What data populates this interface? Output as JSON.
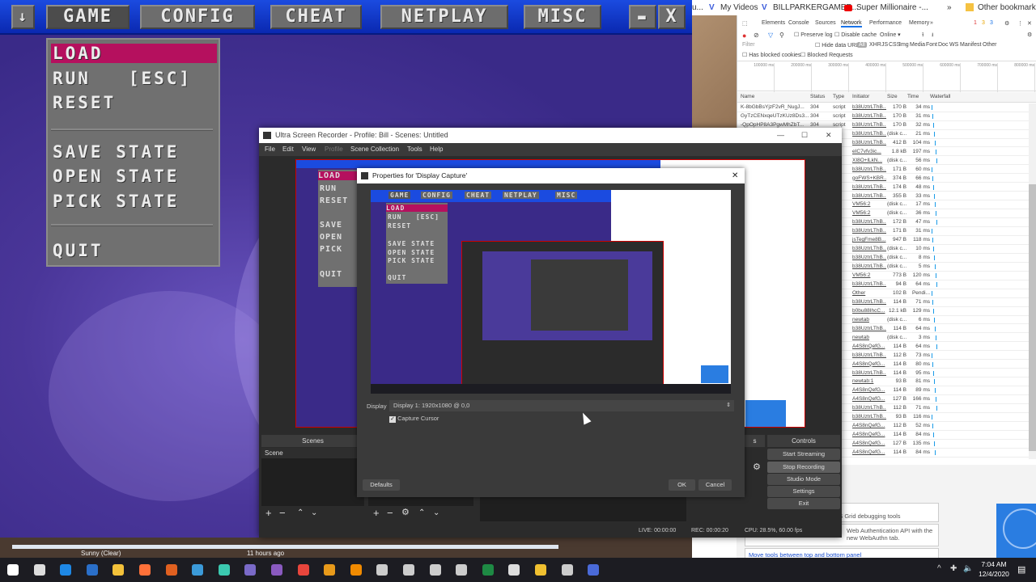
{
  "game": {
    "topbar": {
      "down_icon": "↓",
      "tabs": [
        "GAME",
        "CONFIG",
        "CHEAT",
        "NETPLAY",
        "MISC"
      ],
      "active": "GAME",
      "minimize_icon": "minimize-icon",
      "close_label": "X"
    },
    "menu": {
      "items": [
        "LOAD",
        "RUN   [ESC]",
        "RESET",
        "SAVE STATE",
        "OPEN STATE",
        "PICK STATE",
        "QUIT"
      ],
      "selected": "LOAD"
    },
    "colors": {
      "bar": "#1b4be0",
      "menu": "#707070",
      "highlight": "#b5105e",
      "bg": "#3a2a88"
    }
  },
  "chrome": {
    "bookmarks": [
      "u...",
      "My Videos",
      "BILLPARKERGAMER...",
      "Super Millionaire -...",
      "»",
      "Other bookmarks"
    ],
    "devtools": {
      "tabs": [
        "Elements",
        "Console",
        "Sources",
        "Network",
        "Performance",
        "Memory",
        "»"
      ],
      "active_tab": "Network",
      "counts": {
        "errors": "1",
        "warnings": "3",
        "info": "3"
      },
      "toolbar": {
        "preserve_log": "Preserve log",
        "disable_cache": "Disable cache",
        "throttle": "Online"
      },
      "filter": {
        "placeholder": "Filter",
        "hide_data_urls": "Hide data URLs",
        "types": [
          "All",
          "XHR",
          "JS",
          "CSS",
          "Img",
          "Media",
          "Font",
          "Doc",
          "WS",
          "Manifest",
          "Other"
        ],
        "blocked_cookies": "Has blocked cookies",
        "blocked_requests": "Blocked Requests"
      },
      "overview_ticks": [
        "100000 ms",
        "200000 ms",
        "300000 ms",
        "400000 ms",
        "500000 ms",
        "600000 ms",
        "700000 ms",
        "800000 ms"
      ],
      "columns": [
        "Name",
        "Status",
        "Type",
        "Initiator",
        "Size",
        "Time",
        "Waterfall"
      ],
      "rows": [
        {
          "name": "K-8bGbBsYjzF2vR_NugJ...",
          "status": "304",
          "type": "script",
          "initiator": "b38UztrLThB...",
          "size": "170 B",
          "time": "34 ms"
        },
        {
          "name": "GyTzCENxqeUTzKUz8Ds3...",
          "status": "304",
          "type": "script",
          "initiator": "b38UztrLThB...",
          "size": "170 B",
          "time": "31 ms"
        },
        {
          "name": "-QpOpHP8A3PgwMhZbT...",
          "status": "304",
          "type": "script",
          "initiator": "b38UztrLThB...",
          "size": "170 B",
          "time": "32 ms"
        },
        {
          "initiator": "b38UztrLThB...",
          "size": "(disk c...",
          "time": "21 ms"
        },
        {
          "initiator": "b38UztrLThB...",
          "size": "412 B",
          "time": "104 ms"
        },
        {
          "initiator": "eIC7vfv3ic...",
          "size": "1.8 kB",
          "time": "197 ms"
        },
        {
          "initiator": "XI8O+lLkN...",
          "size": "(disk c...",
          "time": "56 ms"
        },
        {
          "initiator": "b38UztrLThB...",
          "size": "171 B",
          "time": "60 ms"
        },
        {
          "initiator": "goFWS+KBR...",
          "size": "374 B",
          "time": "66 ms"
        },
        {
          "initiator": "b38UztrLThB...",
          "size": "174 B",
          "time": "48 ms"
        },
        {
          "initiator": "b38UztrLThB...",
          "size": "355 B",
          "time": "33 ms"
        },
        {
          "initiator": "VM56:2",
          "size": "(disk c...",
          "time": "17 ms"
        },
        {
          "initiator": "VM56:2",
          "size": "(disk c...",
          "time": "36 ms"
        },
        {
          "initiator": "b38UztrLThB...",
          "size": "172 B",
          "time": "47 ms"
        },
        {
          "initiator": "b38UztrLThB...",
          "size": "171 B",
          "time": "31 ms"
        },
        {
          "initiator": "jsTegFme8B...",
          "size": "947 B",
          "time": "118 ms"
        },
        {
          "initiator": "b38UztrLThB...",
          "size": "(disk c...",
          "time": "10 ms"
        },
        {
          "initiator": "b38UztrLThB...",
          "size": "(disk c...",
          "time": "8 ms"
        },
        {
          "initiator": "b38UztrLThB...",
          "size": "(disk c...",
          "time": "5 ms"
        },
        {
          "initiator": "VM56:2",
          "size": "773 B",
          "time": "120 ms"
        },
        {
          "initiator": "b38UztrLThB...",
          "size": "94 B",
          "time": "64 ms"
        },
        {
          "initiator": "Other",
          "size": "102 B",
          "time": "Pendi..."
        },
        {
          "initiator": "b38UztrLThB...",
          "size": "114 B",
          "time": "71 ms"
        },
        {
          "initiator": "b0bu88IhcC...",
          "size": "12.1 kB",
          "time": "129 ms"
        },
        {
          "initiator": "newtab",
          "size": "(disk c...",
          "time": "6 ms"
        },
        {
          "initiator": "b38UztrLThB...",
          "size": "114 B",
          "time": "64 ms"
        },
        {
          "initiator": "newtab",
          "size": "(disk c...",
          "time": "3 ms"
        },
        {
          "initiator": "A4S8nQefG...",
          "size": "114 B",
          "time": "64 ms"
        },
        {
          "initiator": "b38UztrLThB...",
          "size": "112 B",
          "time": "73 ms"
        },
        {
          "initiator": "A4S8nQefG...",
          "size": "114 B",
          "time": "80 ms"
        },
        {
          "initiator": "b38UztrLThB...",
          "size": "114 B",
          "time": "95 ms"
        },
        {
          "initiator": "newtab:1",
          "size": "93 B",
          "time": "81 ms"
        },
        {
          "initiator": "A4S8nQefG...",
          "size": "114 B",
          "time": "89 ms"
        },
        {
          "initiator": "A4S8nQefG...",
          "size": "127 B",
          "time": "166 ms"
        },
        {
          "initiator": "b38UztrLThB...",
          "size": "112 B",
          "time": "71 ms"
        },
        {
          "initiator": "b38UztrLThB...",
          "size": "93 B",
          "time": "116 ms"
        },
        {
          "initiator": "A4S8nQefG...",
          "size": "112 B",
          "time": "52 ms"
        },
        {
          "initiator": "A4S8nQefG...",
          "size": "114 B",
          "time": "84 ms"
        },
        {
          "initiator": "A4S8nQefG...",
          "size": "127 B",
          "time": "135 ms"
        },
        {
          "initiator": "A4S8nQefG...",
          "size": "114 B",
          "time": "84 ms"
        }
      ],
      "summary": "sources"
    },
    "newtab_cards": [
      "v CSS Grid debugging tools",
      "Web Authentication API with the new WebAuthn tab.",
      "Move tools between top and bottom panel"
    ]
  },
  "obs": {
    "title": "Ultra Screen Recorder - Profile: Bill - Scenes: Untitled",
    "menu": [
      "File",
      "Edit",
      "View",
      "Profile",
      "Scene Collection",
      "Tools",
      "Help"
    ],
    "scenes": {
      "header": "Scenes",
      "items": [
        "Scene"
      ]
    },
    "transitions_partial": "s",
    "controls": {
      "header": "Controls",
      "buttons": [
        "Start Streaming",
        "Stop Recording",
        "Studio Mode",
        "Settings",
        "Exit"
      ]
    },
    "status": {
      "live": "LIVE: 00:00:00",
      "rec": "REC: 00:00:20",
      "cpu": "CPU: 28.5%, 60.00 fps"
    },
    "preview_menu": [
      "LOAD",
      "RUN",
      "RESET",
      "SAVE",
      "OPEN",
      "PICK",
      "QUIT"
    ]
  },
  "properties": {
    "title": "Properties for 'Display Capture'",
    "display_label": "Display",
    "display_value": "Display 1: 1920x1080 @ 0,0",
    "capture_cursor": {
      "label": "Capture Cursor",
      "checked": true
    },
    "defaults": "Defaults",
    "ok": "OK",
    "cancel": "Cancel",
    "preview_topbar": [
      "GAME",
      "CONFIG",
      "CHEAT",
      "NETPLAY",
      "MISC"
    ],
    "preview_menu": [
      "LOAD",
      "RUN   [ESC]",
      "RESET",
      "SAVE STATE",
      "OPEN STATE",
      "PICK STATE",
      "QUIT"
    ]
  },
  "desktop": {
    "weather": "Sunny (Clear)",
    "time_ago": "11 hours ago"
  },
  "taskbar": {
    "icons": [
      "start-icon",
      "task-view-icon",
      "edge-icon",
      "control-panel-icon",
      "file-explorer-icon",
      "firefox-icon",
      "waterfox-icon",
      "app-icon",
      "app-icon",
      "winamp-icon",
      "app-icon",
      "chrome-icon",
      "media-player-icon",
      "vlc-icon",
      "retroarch-icon",
      "retroarch-icon",
      "retroarch-icon",
      "retroarch-icon",
      "excel-icon",
      "security-icon",
      "store-icon",
      "snipping-icon",
      "obs-icon"
    ],
    "clock_time": "7:04 AM",
    "clock_date": "12/4/2020"
  }
}
